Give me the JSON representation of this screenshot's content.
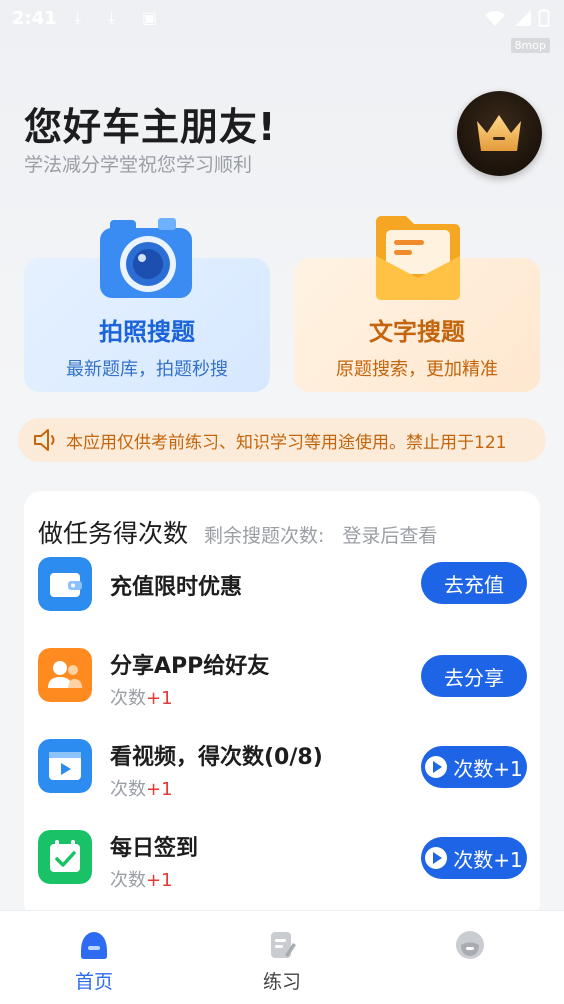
{
  "status_bar": {
    "time": "2:41",
    "watermark": "8mop"
  },
  "header": {
    "title": "您好车主朋友!",
    "subtitle": "学法减分学堂祝您学习顺利"
  },
  "features": [
    {
      "title": "拍照搜题",
      "subtitle": "最新题库，拍题秒搜"
    },
    {
      "title": "文字搜题",
      "subtitle": "原题搜索，更加精准"
    }
  ],
  "notice": {
    "text": "本应用仅供考前练习、知识学习等用途使用。禁止用于121"
  },
  "tasks": {
    "title": "做任务得次数",
    "remaining_label": "剩余搜题次数:",
    "remaining_value": "登录后查看",
    "items": [
      {
        "name": "充值限时优惠",
        "reward_prefix": "",
        "reward_plus": "",
        "button": "去充值",
        "icon": "wallet-icon"
      },
      {
        "name": "分享APP给好友",
        "reward_prefix": "次数",
        "reward_plus": "+1",
        "button": "去分享",
        "icon": "friends-icon"
      },
      {
        "name": "看视频，得次数(0/8)",
        "reward_prefix": "次数",
        "reward_plus": "+1",
        "button": "次数+1",
        "icon": "video-icon"
      },
      {
        "name": "每日签到",
        "reward_prefix": "次数",
        "reward_plus": "+1",
        "button": "次数+1",
        "icon": "calendar-check-icon"
      }
    ]
  },
  "nav": {
    "items": [
      {
        "label": "首页",
        "icon": "home-icon",
        "active": true
      },
      {
        "label": "练习",
        "icon": "practice-icon",
        "active": false
      },
      {
        "label": "",
        "icon": "profile-icon",
        "active": false
      }
    ]
  },
  "colors": {
    "primary": "#1e64e6",
    "accent_orange": "#c4650d",
    "plus_red": "#e53935"
  }
}
